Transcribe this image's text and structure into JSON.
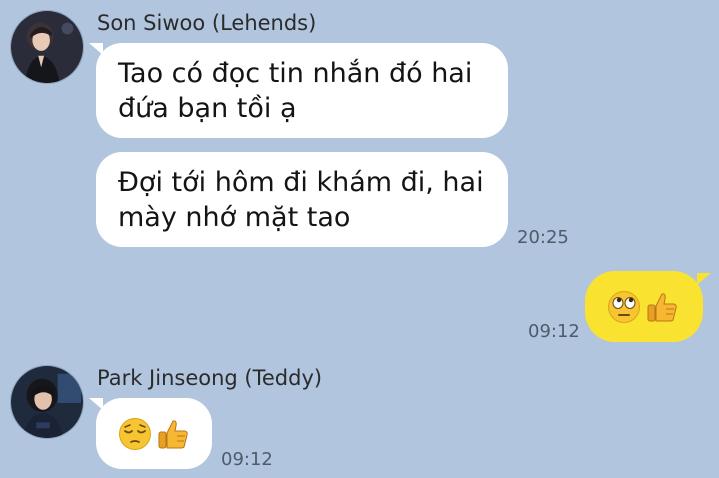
{
  "messages": [
    {
      "sender": "Son Siwoo (Lehends)",
      "bubbles": [
        "Tao có đọc tin nhắn đó hai\nđứa bạn tồi ạ",
        "Đợi tới hôm đi khám đi, hai\nmày nhớ mặt tao"
      ],
      "time": "20:25",
      "avatar_icon": "profile-photo-icon"
    },
    {
      "sender": "me",
      "emojis": [
        "rolling-eyes-emoji",
        "thumbs-up-emoji"
      ],
      "time": "09:12"
    },
    {
      "sender": "Park Jinseong (Teddy)",
      "emojis": [
        "pensive-face-emoji",
        "thumbs-up-emoji"
      ],
      "time": "09:12",
      "avatar_icon": "profile-photo-icon"
    }
  ],
  "colors": {
    "background": "#b1c5de",
    "incoming_bubble": "#ffffff",
    "outgoing_bubble": "#f9e330",
    "emoji_face": "#f7c531",
    "thumb": "#f7b731"
  }
}
